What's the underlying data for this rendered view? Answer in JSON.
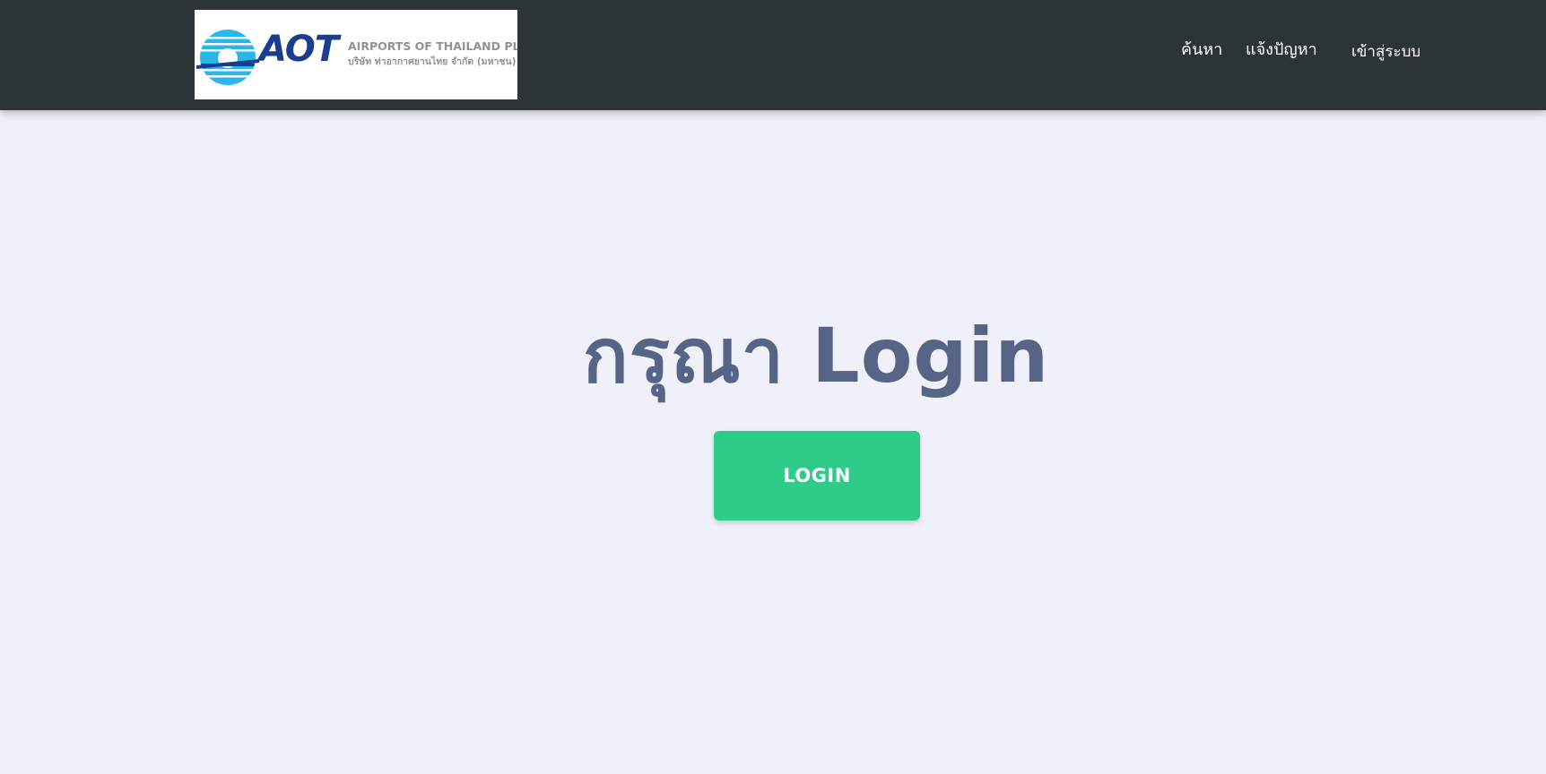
{
  "header": {
    "logo": {
      "brand": "AOT",
      "company_name": "AIRPORTS OF THAILAND PLC.",
      "company_name_th": "บริษัท ท่าอากาศยานไทย จำกัด (มหาชน)",
      "icon": "aot-logo-icon"
    },
    "nav": {
      "search": "ค้นหา",
      "report_problem": "แจ้งปัญหา",
      "sign_in": "เข้าสู่ระบบ"
    }
  },
  "main": {
    "heading": "กรุณา Login",
    "login_button": "LOGIN"
  },
  "colors": {
    "header_bg": "#2d3436",
    "page_bg": "#eff0f9",
    "heading": "#566585",
    "button_bg": "#2ecc88",
    "logo_blue": "#1a3d8f",
    "logo_cyan": "#29b6e8"
  }
}
